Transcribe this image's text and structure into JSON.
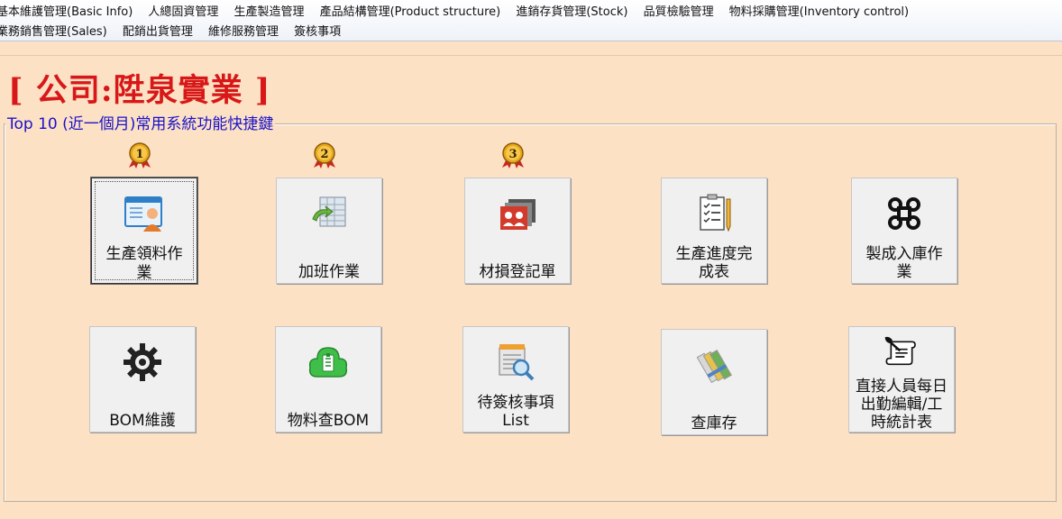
{
  "menu": {
    "row1": [
      "基本維護管理(Basic Info)",
      "人總固資管理",
      "生產製造管理",
      "產品結構管理(Product structure)",
      "進銷存貨管理(Stock)",
      "品質檢驗管理",
      "物料採購管理(Inventory control)"
    ],
    "row2": [
      "業務銷售管理(Sales)",
      "配銷出貨管理",
      "維修服務管理",
      "簽核事項"
    ]
  },
  "company": "[ 公司:陞泉實業 ]",
  "shortcuts": {
    "title": "Top 10 (近一個月)常用系統功能快捷鍵",
    "ranks": [
      "1",
      "2",
      "3"
    ],
    "tiles": [
      {
        "label": "生產領料作業",
        "icon": "user-card-icon",
        "selected": true
      },
      {
        "label": "加班作業",
        "icon": "spreadsheet-arrow-icon",
        "selected": false
      },
      {
        "label": "材損登記單",
        "icon": "id-cards-icon",
        "selected": false
      },
      {
        "label": "生產進度完成表",
        "icon": "checklist-pencil-icon",
        "selected": false
      },
      {
        "label": "製成入庫作業",
        "icon": "command-key-icon",
        "selected": false
      },
      {
        "label": "BOM維護",
        "icon": "gear-icon",
        "selected": false
      },
      {
        "label": "物料查BOM",
        "icon": "green-cloud-icon",
        "selected": false
      },
      {
        "label": "待簽核事項List",
        "icon": "document-search-icon",
        "selected": false
      },
      {
        "label": "查庫存",
        "icon": "color-swatches-icon",
        "selected": false
      },
      {
        "label": "直接人員每日出勤編輯/工時統計表",
        "icon": "scroll-quill-icon",
        "selected": false
      }
    ]
  },
  "colors": {
    "background": "#fde1c4",
    "company_title": "#d81818",
    "group_title": "#1a12c8",
    "tile_face": "#f0f0f0"
  }
}
